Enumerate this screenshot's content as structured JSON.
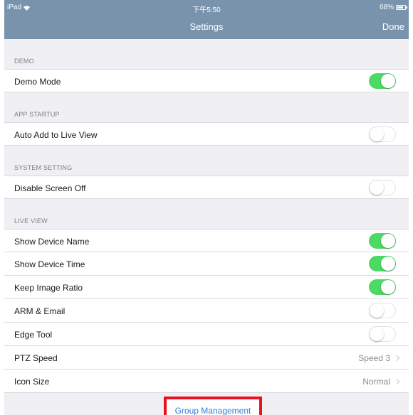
{
  "statusbar": {
    "device": "iPad",
    "time": "下午5:50",
    "battery": "68%"
  },
  "navbar": {
    "title": "Settings",
    "done_label": "Done"
  },
  "sections": [
    {
      "header": "DEMO",
      "rows": [
        {
          "label": "Demo Mode",
          "toggle": true
        }
      ]
    },
    {
      "header": "APP STARTUP",
      "rows": [
        {
          "label": "Auto Add to Live View",
          "toggle": false
        }
      ]
    },
    {
      "header": "SYSTEM SETTING",
      "rows": [
        {
          "label": "Disable Screen Off",
          "toggle": false
        }
      ]
    },
    {
      "header": "LIVE VIEW",
      "rows": [
        {
          "label": "Show Device Name",
          "toggle": true
        },
        {
          "label": "Show Device Time",
          "toggle": true
        },
        {
          "label": "Keep Image Ratio",
          "toggle": true
        },
        {
          "label": "ARM & Email",
          "toggle": false
        },
        {
          "label": "Edge Tool",
          "toggle": false
        },
        {
          "label": "PTZ Speed",
          "value": "Speed 3"
        },
        {
          "label": "Icon Size",
          "value": "Normal"
        }
      ]
    }
  ],
  "group_management": {
    "label": "Group Management"
  },
  "colors": {
    "bar": "#7a93ad",
    "toggle_on": "#4cd964",
    "link": "#2f7fd8",
    "highlight": "#e8121c"
  }
}
